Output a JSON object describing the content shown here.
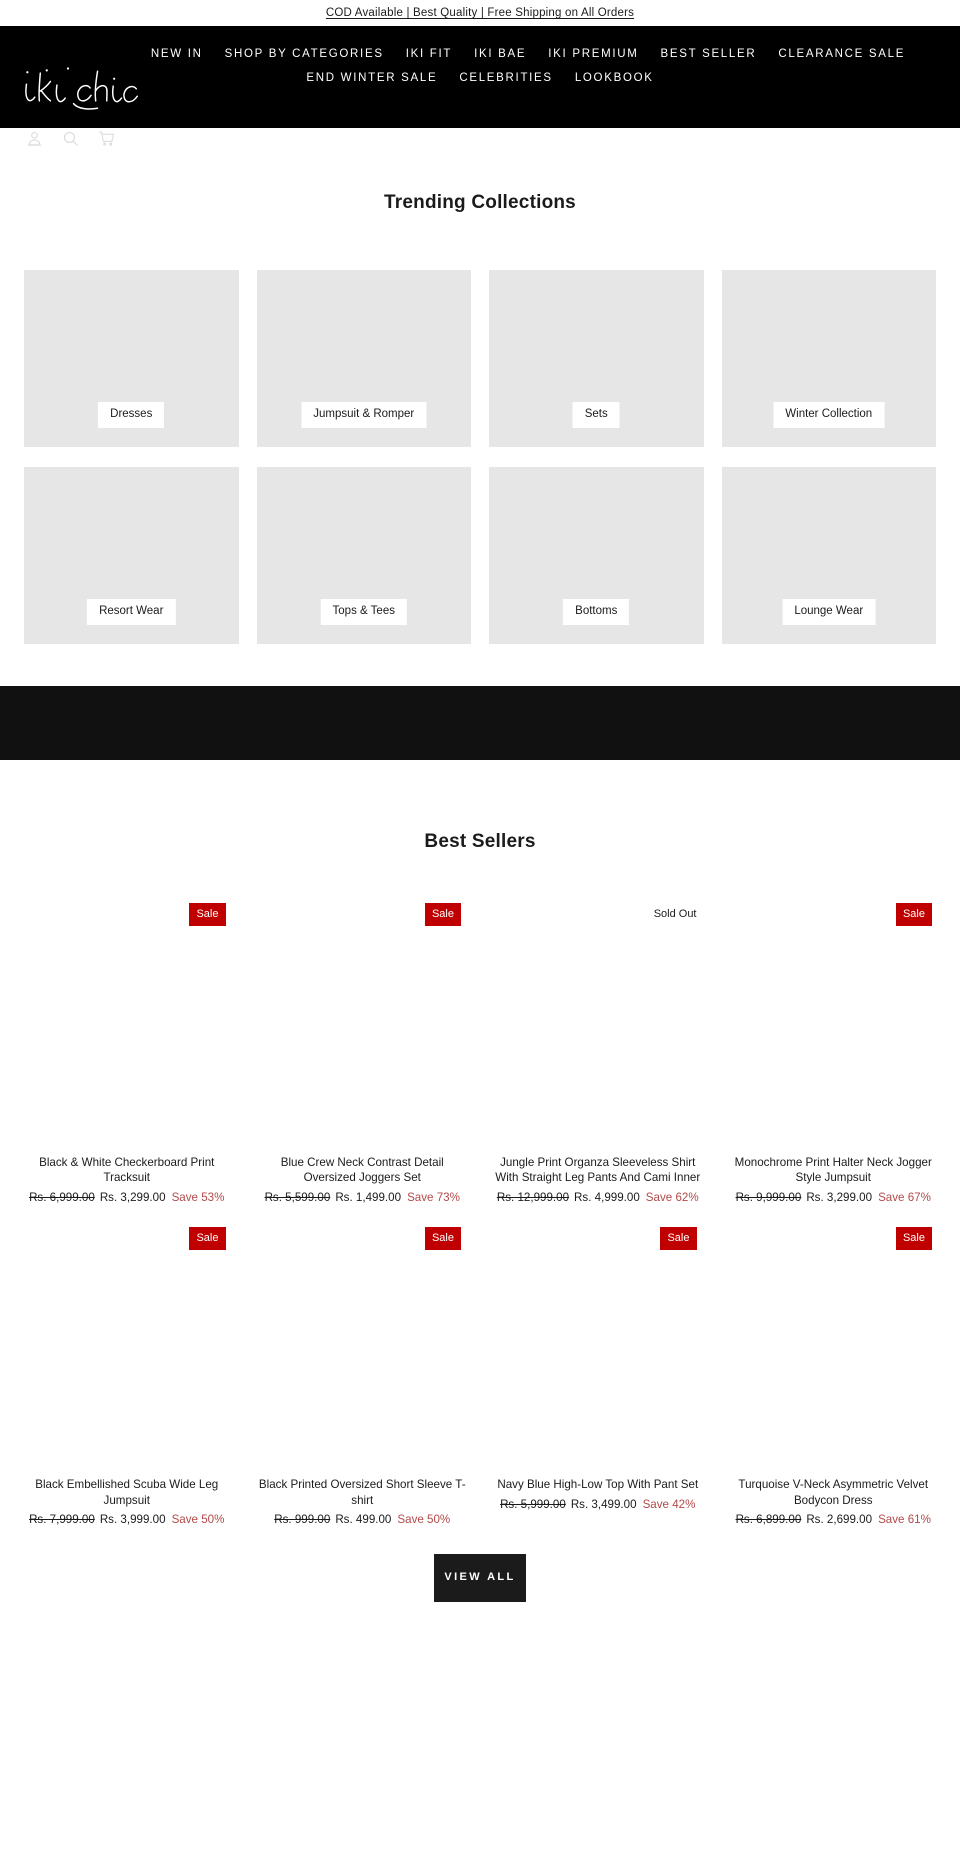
{
  "announcement": {
    "text": "COD Available | Best Quality | Free Shipping on All Orders"
  },
  "header": {
    "logo_text": "iki chic",
    "nav_row1": [
      {
        "label": "NEW IN"
      },
      {
        "label": "SHOP BY CATEGORIES"
      },
      {
        "label": "IKI FIT"
      },
      {
        "label": "IKI BAE"
      },
      {
        "label": "IKI PREMIUM"
      },
      {
        "label": "BEST SELLER"
      },
      {
        "label": "CLEARANCE SALE"
      }
    ],
    "nav_row2": [
      {
        "label": "END WINTER SALE"
      },
      {
        "label": "CELEBRITIES"
      },
      {
        "label": "LOOKBOOK"
      }
    ],
    "icons": [
      {
        "name": "account-icon"
      },
      {
        "name": "search-icon"
      },
      {
        "name": "cart-icon"
      }
    ]
  },
  "trending": {
    "title": "Trending Collections",
    "cards": [
      {
        "label": "Dresses"
      },
      {
        "label": "Jumpsuit & Romper"
      },
      {
        "label": "Sets"
      },
      {
        "label": "Winter Collection"
      },
      {
        "label": "Resort Wear"
      },
      {
        "label": "Tops & Tees"
      },
      {
        "label": "Bottoms"
      },
      {
        "label": "Lounge Wear"
      }
    ]
  },
  "bestsellers": {
    "title": "Best Sellers",
    "view_all_label": "VIEW ALL",
    "products": [
      {
        "badge": "Sale",
        "badge_type": "sale",
        "title": "Black & White Checkerboard Print Tracksuit",
        "price_old": "Rs. 6,999.00",
        "price_new": "Rs. 3,299.00",
        "save": "Save 53%"
      },
      {
        "badge": "Sale",
        "badge_type": "sale",
        "title": "Blue Crew Neck Contrast Detail Oversized Joggers Set",
        "price_old": "Rs. 5,599.00",
        "price_new": "Rs. 1,499.00",
        "save": "Save 73%"
      },
      {
        "badge": "Sold Out",
        "badge_type": "soldout",
        "title": "Jungle Print Organza Sleeveless Shirt With Straight Leg Pants And Cami Inner",
        "price_old": "Rs. 12,999.00",
        "price_new": "Rs. 4,999.00",
        "save": "Save 62%"
      },
      {
        "badge": "Sale",
        "badge_type": "sale",
        "title": "Monochrome Print Halter Neck Jogger Style Jumpsuit",
        "price_old": "Rs. 9,999.00",
        "price_new": "Rs. 3,299.00",
        "save": "Save 67%"
      },
      {
        "badge": "Sale",
        "badge_type": "sale",
        "title": "Black Embellished Scuba Wide Leg Jumpsuit",
        "price_old": "Rs. 7,999.00",
        "price_new": "Rs. 3,999.00",
        "save": "Save 50%"
      },
      {
        "badge": "Sale",
        "badge_type": "sale",
        "title": "Black Printed Oversized Short Sleeve T-shirt",
        "price_old": "Rs. 999.00",
        "price_new": "Rs. 499.00",
        "save": "Save 50%"
      },
      {
        "badge": "Sale",
        "badge_type": "sale",
        "title": "Navy Blue High-Low Top With Pant Set",
        "price_old": "Rs. 5,999.00",
        "price_new": "Rs. 3,499.00",
        "save": "Save 42%"
      },
      {
        "badge": "Sale",
        "badge_type": "sale",
        "title": "Turquoise V-Neck Asymmetric Velvet Bodycon Dress",
        "price_old": "Rs. 6,899.00",
        "price_new": "Rs. 2,699.00",
        "save": "Save 61%"
      }
    ]
  },
  "colors": {
    "sale_badge": "#c00000",
    "save_text": "#b24a4a",
    "header_bg": "#000000",
    "card_bg": "#e6e6e6",
    "dark_band": "#111111"
  }
}
